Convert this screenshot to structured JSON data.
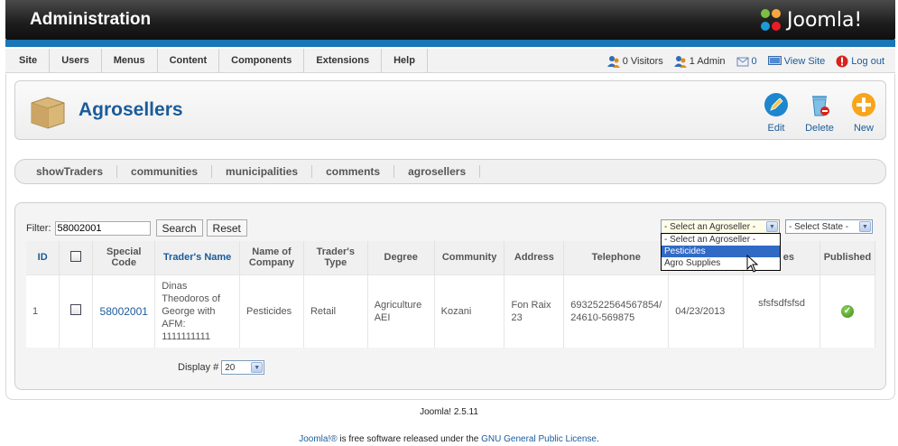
{
  "header": {
    "title": "Administration",
    "logo_text": "Joomla!"
  },
  "menu": [
    "Site",
    "Users",
    "Menus",
    "Content",
    "Components",
    "Extensions",
    "Help"
  ],
  "status": {
    "visitors": "0 Visitors",
    "admins": "1 Admin",
    "messages": "0",
    "view_site": "View Site",
    "logout": "Log out"
  },
  "toolbar": {
    "title": "Agrosellers",
    "edit": "Edit",
    "delete": "Delete",
    "new": "New"
  },
  "submenu": [
    "showTraders",
    "communities",
    "municipalities",
    "comments",
    "agrosellers"
  ],
  "filter": {
    "label": "Filter:",
    "value": "58002001",
    "search": "Search",
    "reset": "Reset",
    "agroseller_select": "- Select an Agroseller -",
    "state_select": "- Select State -"
  },
  "dropdown": {
    "options": [
      "- Select an Agroseller -",
      "Pesticides",
      "Agro Supplies"
    ],
    "highlighted": "Pesticides"
  },
  "table": {
    "headers": {
      "id": "ID",
      "special_code": "Special Code",
      "traders_name": "Trader's Name",
      "company": "Name of Company",
      "type": "Trader's Type",
      "degree": "Degree",
      "community": "Community",
      "address": "Address",
      "telephone": "Telephone",
      "date": "",
      "notes": "es",
      "published": "Published"
    },
    "row": {
      "id": "1",
      "special_code": "58002001",
      "traders_name": "Dinas Theodoros of George with AFM: 1111111111",
      "company": "Pesticides",
      "type": "Retail",
      "degree": "Agriculture AEI",
      "community": "Kozani",
      "address": "Fon Raix 23",
      "telephone": "6932522564567854/ 24610-569875",
      "date": "04/23/2013",
      "notes": "sfsfsdfsfsd"
    }
  },
  "pagination": {
    "label": "Display #",
    "value": "20"
  },
  "footer": {
    "version": "Joomla! 2.5.11",
    "license_pre": "Joomla!®",
    "license_mid": " is free software released under the ",
    "license_link": "GNU General Public License",
    "license_post": "."
  },
  "colors": {
    "brand_blue": "#1b76b8",
    "link": "#1b5b9a",
    "highlight": "#316ac5"
  }
}
